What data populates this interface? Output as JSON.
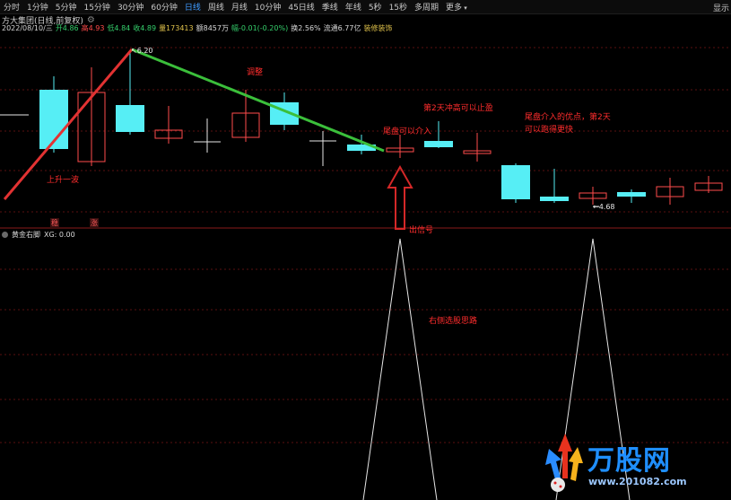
{
  "toolbar": {
    "items": [
      "分时",
      "1分钟",
      "5分钟",
      "15分钟",
      "30分钟",
      "60分钟",
      "日线",
      "周线",
      "月线",
      "10分钟",
      "45日线",
      "季线",
      "年线",
      "5秒",
      "15秒",
      "多周期",
      "更多"
    ],
    "active": "日线",
    "right_label": "显示"
  },
  "header": {
    "title": "方大集团(日线,前复权)"
  },
  "info_row": {
    "date": "2022/08/10/三",
    "open": "开4.86",
    "high": "高4.93",
    "low": "低4.84",
    "close": "收4.89",
    "volume": "量173413",
    "amount": "额8457万",
    "change": "幅-0.01(-0.20%)",
    "turnover": "换2.56%",
    "float": "流通6.77亿",
    "concept": "装修装饰"
  },
  "main_chart": {
    "high_label": "6.20",
    "low_label": "4.68",
    "markers": [
      "稳",
      "涨"
    ],
    "annotations": {
      "rise": "上升一波",
      "adjust": "调整",
      "tail_entry": "尾盘可以介入",
      "next_day": "第2天冲高可以止盈",
      "advantage_line1": "尾盘介入的优点，第2天",
      "advantage_line2": "可以跑得更快",
      "signal": "出信号"
    },
    "colors": {
      "up": "#ff4c4c",
      "down": "#56eef5",
      "uptrend": "#e23232",
      "downtrend": "#3bbf3b",
      "arrow": "#d42828",
      "grid": "#6a1515"
    }
  },
  "sub_chart": {
    "indicator_name": "黄金右脚",
    "indicator_value": "XG: 0.00",
    "annotation": "右侧选股思路"
  },
  "watermark": {
    "text": "万股网",
    "url": "www.201082.com"
  }
}
